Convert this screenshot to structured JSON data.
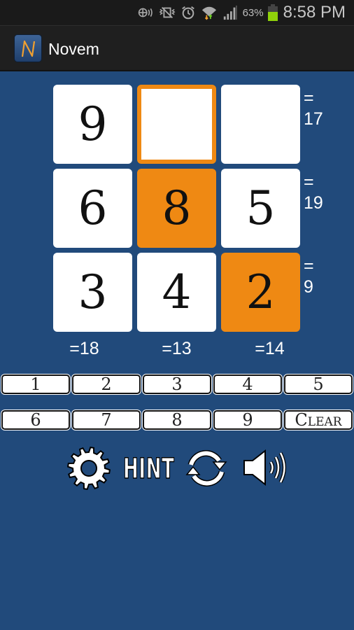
{
  "status_bar": {
    "icons": [
      "nfc-icon",
      "vibrate-icon",
      "alarm-icon",
      "wifi-icon",
      "signal-icon"
    ],
    "battery_percent": "63%",
    "battery_level": 0.63,
    "time": "8:58 PM"
  },
  "action_bar": {
    "app_icon_letter": "N",
    "title": "Novem"
  },
  "grid": {
    "cells": [
      {
        "value": "9",
        "state": "normal"
      },
      {
        "value": "",
        "state": "selected"
      },
      {
        "value": "",
        "state": "normal"
      },
      {
        "value": "6",
        "state": "normal"
      },
      {
        "value": "8",
        "state": "highlight"
      },
      {
        "value": "5",
        "state": "normal"
      },
      {
        "value": "3",
        "state": "normal"
      },
      {
        "value": "4",
        "state": "normal"
      },
      {
        "value": "2",
        "state": "highlight"
      }
    ],
    "row_sums": [
      {
        "eq": "=",
        "value": "17"
      },
      {
        "eq": "=",
        "value": "19"
      },
      {
        "eq": "=",
        "value": "9"
      }
    ],
    "col_sums": [
      "=18",
      "=13",
      "=14"
    ]
  },
  "keypad": {
    "row1": [
      "1",
      "2",
      "3",
      "4",
      "5"
    ],
    "row2": [
      "6",
      "7",
      "8",
      "9",
      "Clear"
    ]
  },
  "tools": {
    "settings": "settings",
    "hint_label": "HINT",
    "restart": "restart",
    "sound": "sound"
  },
  "colors": {
    "background": "#214a7b",
    "accent": "#ef8913",
    "status_bar": "#1a1a1a",
    "action_bar": "#1f1f1f"
  }
}
